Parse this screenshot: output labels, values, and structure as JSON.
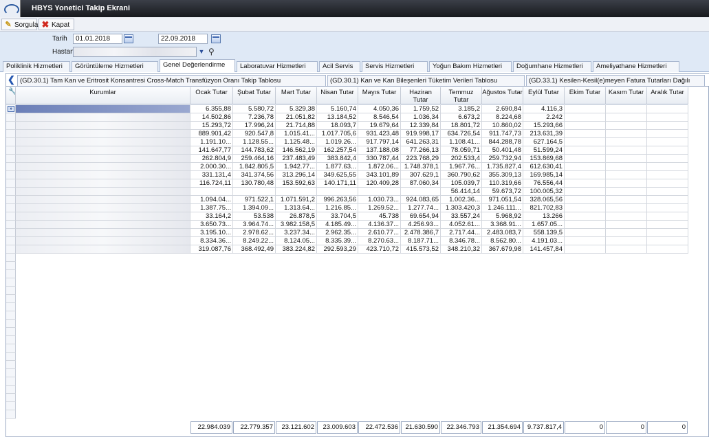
{
  "window": {
    "title": "HBYS Yonetici Takip Ekrani"
  },
  "toolbar": {
    "query_label": "Sorgula",
    "close_label": "Kapat"
  },
  "filters": {
    "date_label": "Tarih",
    "start_date": "01.01.2018",
    "end_date": "22.09.2018",
    "hospital_label": "Hastane"
  },
  "tabs": [
    "Poliklinik Hizmetleri",
    "Görüntüleme Hizmetleri",
    "Genel Değerlendirme",
    "Laboratuvar Hizmetleri",
    "Acil Servis",
    "Servis Hizmetleri",
    "Yoğun Bakım Hizmetleri",
    "Doğumhane Hizmetleri",
    "Ameliyathane Hizmetleri"
  ],
  "active_tab": "Genel Değerlendirme",
  "subtabs": [
    "(GD.30.1) Tam Kan ve Eritrosit Konsantresi Cross-Match Transfüzyon Oranı Takip Tablosu",
    "(GD.30.1) Kan ve Kan Bileşenleri Tüketim Verileri Tablosu",
    "(GD.33.1) Kesilen-Kesil(e)meyen Fatura Tutarları Dağılı"
  ],
  "table": {
    "headers": [
      "Kurumlar",
      "Ocak Tutar",
      "Şubat Tutar",
      "Mart Tutar",
      "Nisan Tutar",
      "Mayıs Tutar",
      "Haziran Tutar",
      "Temmuz Tutar",
      "Ağustos Tutar",
      "Eylül Tutar",
      "Ekim Tutar",
      "Kasım Tutar",
      "Aralık Tutar"
    ],
    "rows": [
      [
        "6.355,88",
        "5.580,72",
        "5.329,38",
        "5.160,74",
        "4.050,36",
        "1.759,52",
        "3.185,2",
        "2.690,84",
        "4.116,3",
        "",
        "",
        ""
      ],
      [
        "14.502,86",
        "7.236,78",
        "21.051,82",
        "13.184,52",
        "8.546,54",
        "1.036,34",
        "6.673,2",
        "8.224,68",
        "2.242",
        "",
        "",
        ""
      ],
      [
        "15.293,72",
        "17.996,24",
        "21.714,88",
        "18.093,7",
        "19.679,64",
        "12.339,84",
        "18.801,72",
        "10.860,02",
        "15.293,66",
        "",
        "",
        ""
      ],
      [
        "889.901,42",
        "920.547,8",
        "1.015.41...",
        "1.017.705,6",
        "931.423,48",
        "919.998,17",
        "634.726,54",
        "911.747,73",
        "213.631,39",
        "",
        "",
        ""
      ],
      [
        "1.191.10...",
        "1.128.55...",
        "1.125.48...",
        "1.019.26...",
        "917.797,14",
        "641.263,31",
        "1.108.41...",
        "844.288,78",
        "627.164,5",
        "",
        "",
        ""
      ],
      [
        "141.647,77",
        "144.783,62",
        "146.562,19",
        "162.257,54",
        "137.188,08",
        "77.266,13",
        "78.059,71",
        "50.401,48",
        "51.599,24",
        "",
        "",
        ""
      ],
      [
        "262.804,9",
        "259.464,16",
        "237.483,49",
        "383.842,4",
        "330.787,44",
        "223.768,29",
        "202.533,4",
        "259.732,94",
        "153.869,68",
        "",
        "",
        ""
      ],
      [
        "2.000.30...",
        "1.842.805,5",
        "1.942.77...",
        "1.877.63...",
        "1.872.06...",
        "1.748.378,1",
        "1.967.76...",
        "1.735.827,4",
        "612.630,41",
        "",
        "",
        ""
      ],
      [
        "331.131,4",
        "341.374,56",
        "313.296,14",
        "349.625,55",
        "343.101,89",
        "307.629,1",
        "360.790,62",
        "355.309,13",
        "169.985,14",
        "",
        "",
        ""
      ],
      [
        "116.724,11",
        "130.780,48",
        "153.592,63",
        "140.171,11",
        "120.409,28",
        "87.060,34",
        "105.039,7",
        "110.319,66",
        "76.556,44",
        "",
        "",
        ""
      ],
      [
        "",
        "",
        "",
        "",
        "",
        "",
        "56.414,14",
        "59.673,72",
        "100.005,32",
        "",
        "",
        ""
      ],
      [
        "1.094.04...",
        "971.522,1",
        "1.071.591,2",
        "996.263,56",
        "1.030.73...",
        "924.083,65",
        "1.002.36...",
        "971.051,54",
        "328.065,56",
        "",
        "",
        ""
      ],
      [
        "1.387.75...",
        "1.394.09...",
        "1.313.64...",
        "1.216.85...",
        "1.269.52...",
        "1.277.74...",
        "1.303.420,3",
        "1.246.111...",
        "821.702,83",
        "",
        "",
        ""
      ],
      [
        "33.164,2",
        "53.538",
        "26.878,5",
        "33.704,5",
        "45.738",
        "69.654,94",
        "33.557,24",
        "5.968,92",
        "13.266",
        "",
        "",
        ""
      ],
      [
        "3.650.73...",
        "3.964.74...",
        "3.982.158,5",
        "4.185.49...",
        "4.136.37...",
        "4.256.93...",
        "4.052.61...",
        "3.368.91...",
        "1.657.05...",
        "",
        "",
        ""
      ],
      [
        "3.195.10...",
        "2.978.62...",
        "3.237.34...",
        "2.962.35...",
        "2.610.77...",
        "2.478.386,7",
        "2.717.44...",
        "2.483.083,7",
        "558.139,5",
        "",
        "",
        ""
      ],
      [
        "8.334.36...",
        "8.249.22...",
        "8.124.05...",
        "8.335.39...",
        "8.270.63...",
        "8.187.71...",
        "8.346.78...",
        "8.562.80...",
        "4.191.03...",
        "",
        "",
        ""
      ],
      [
        "319.087,76",
        "368.492,49",
        "383.224,82",
        "292.593,29",
        "423.710,72",
        "415.573,52",
        "348.210,32",
        "367.679,98",
        "141.457,84",
        "",
        "",
        ""
      ]
    ],
    "totals": [
      "22.984.039",
      "22.779.357",
      "23.121.602",
      "23.009.603",
      "22.472.536",
      "21.630.590",
      "22.346.793",
      "21.354.694",
      "9.737.817,4",
      "0",
      "0",
      "0"
    ]
  }
}
